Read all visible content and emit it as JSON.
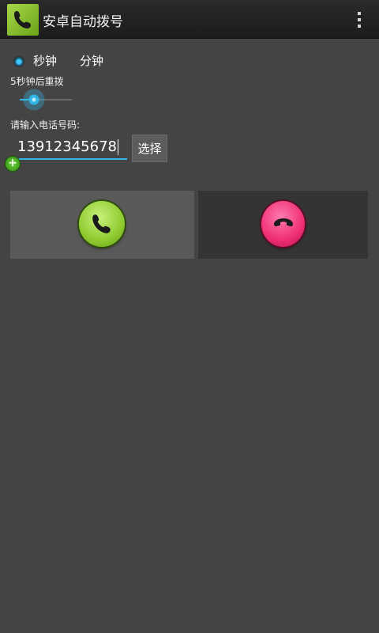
{
  "app": {
    "title": "安卓自动拨号"
  },
  "radio": {
    "seconds": "秒钟",
    "minutes": "分钟",
    "selected": "秒钟"
  },
  "redial": {
    "label": "5秒钟后重拨",
    "slider_value_fraction": 0.3
  },
  "phone": {
    "label": "请输入电话号码:",
    "value": "13912345678",
    "select_label": "选择"
  },
  "icons": {
    "app": "phone-icon",
    "menu": "overflow-menu-icon",
    "call": "call-icon",
    "hangup": "hangup-icon",
    "add": "plus-icon"
  },
  "colors": {
    "accent": "#33b5e5",
    "call": "#8fcb2f",
    "hangup": "#ee2e73",
    "background": "#454444"
  }
}
